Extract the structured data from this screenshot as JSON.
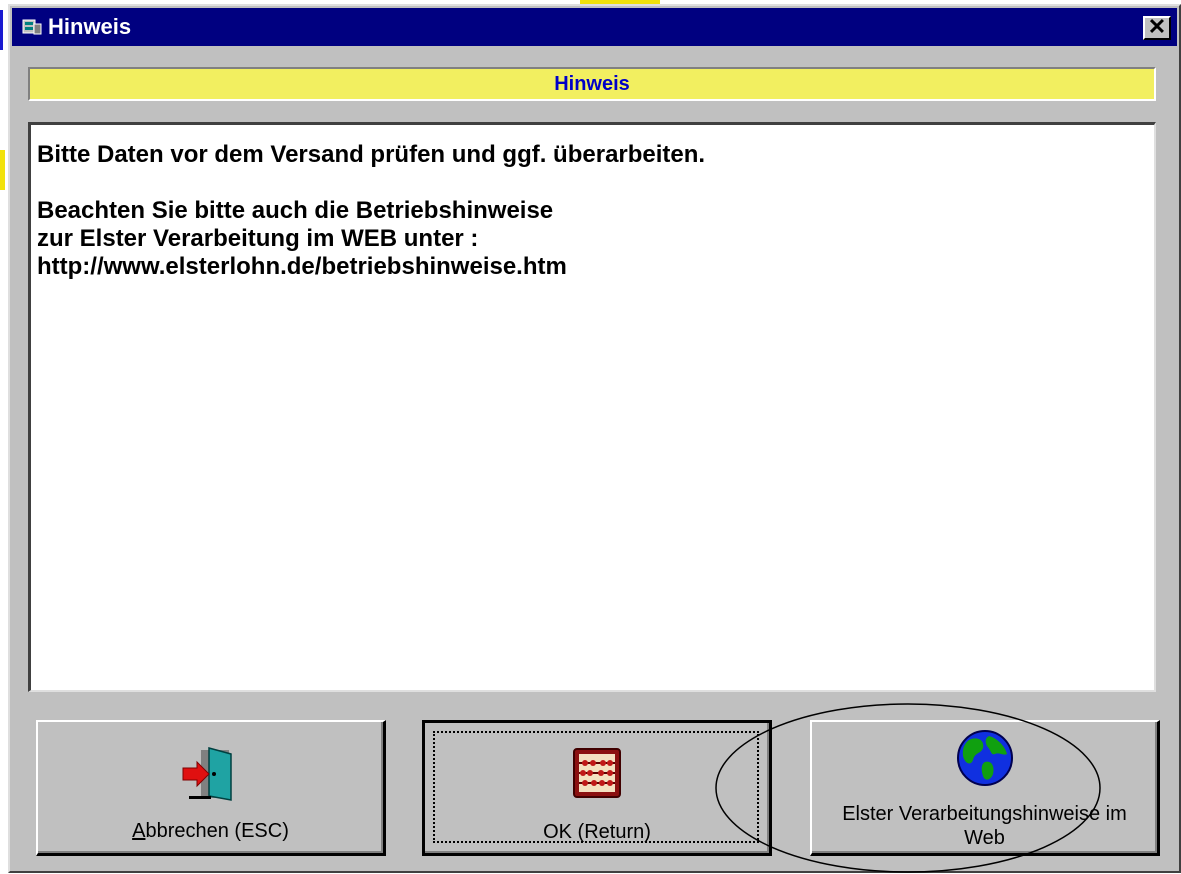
{
  "window": {
    "title": "Hinweis",
    "close_glyph": "✕"
  },
  "header": {
    "title": "Hinweis",
    "background": "#f2ef60",
    "text_color": "#0000c8"
  },
  "message": {
    "lines": [
      "Bitte Daten vor dem Versand prüfen und ggf. überarbeiten.",
      "",
      "Beachten Sie bitte auch die Betriebshinweise",
      "zur Elster Verarbeitung im WEB unter :",
      "http://www.elsterlohn.de/betriebshinweise.htm"
    ]
  },
  "buttons": {
    "cancel": {
      "accel": "A",
      "rest": "bbrechen (ESC)",
      "icon": "exit-door-icon"
    },
    "ok": {
      "label": "OK (Return)",
      "icon": "abacus-icon"
    },
    "web": {
      "label_line1": "Elster Verarbeitungshinweise im",
      "label_line2": "Web",
      "icon": "globe-icon"
    }
  },
  "colors": {
    "titlebar": "#000080",
    "dialog": "#c0c0c0"
  }
}
